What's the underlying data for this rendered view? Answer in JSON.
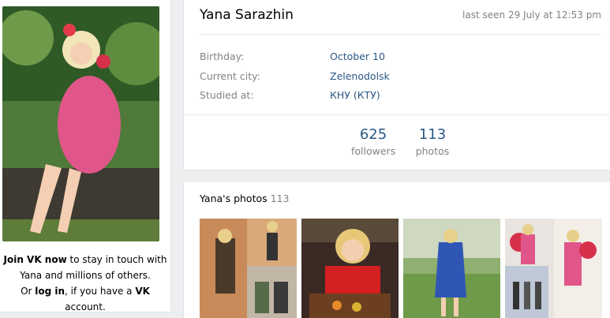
{
  "profile": {
    "name": "Yana Sarazhin",
    "last_seen": "last seen 29 July at 12:53 pm",
    "info": [
      {
        "label": "Birthday:",
        "value": "October 10"
      },
      {
        "label": "Current city:",
        "value": "Zelenodolsk"
      },
      {
        "label": "Studied at:",
        "value": "КНУ (КТУ)"
      }
    ],
    "counters": [
      {
        "value": "625",
        "label": "followers"
      },
      {
        "value": "113",
        "label": "photos"
      }
    ]
  },
  "join": {
    "line1_bold": "Join VK now",
    "line1_rest": " to stay in touch with",
    "line2": "Yana and millions of others.",
    "line3_pre": "Or ",
    "line3_login": "log in",
    "line3_mid": ", if you have a ",
    "line3_vk": "VK",
    "line3_post": " account."
  },
  "photos": {
    "title": "Yana's photos",
    "count": "113"
  },
  "colors": {
    "link": "#2a5885",
    "muted": "#828282",
    "background": "#edeef0"
  }
}
